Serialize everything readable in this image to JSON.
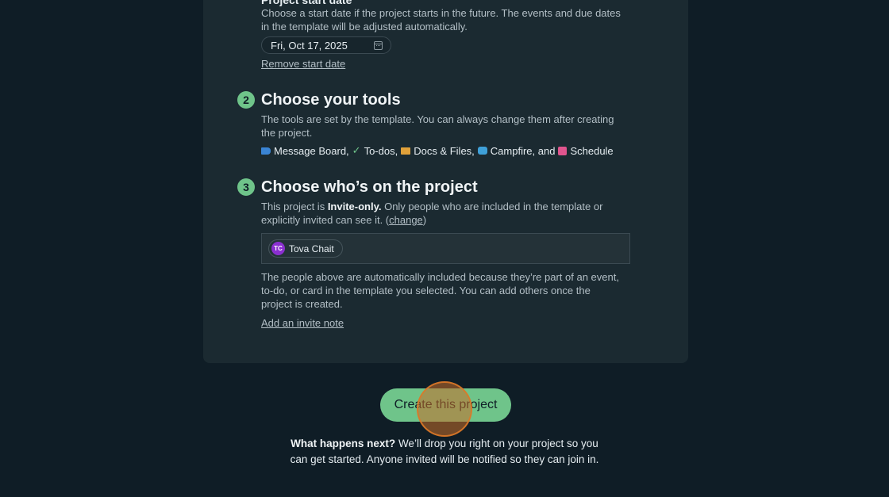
{
  "start_date": {
    "title": "Project start date",
    "description_line1": "Choose a start date if the project starts in the future. The events and due dates",
    "description_line2": "in the template will be adjusted automatically.",
    "date_value": "Fri, Oct 17, 2025",
    "remove_link": "Remove start date"
  },
  "step2": {
    "number": "2",
    "title": "Choose your tools",
    "description_line1": "The tools are set by the template. You can always change them after creating",
    "description_line2": "the project.",
    "tools": [
      {
        "label": "Message Board,",
        "icon": "megaphone-icon"
      },
      {
        "label": "To-dos,",
        "icon": "checkmark-icon"
      },
      {
        "label": "Docs & Files,",
        "icon": "folder-icon"
      },
      {
        "label": "Campfire, and",
        "icon": "chat-bubble-icon"
      },
      {
        "label": "Schedule",
        "icon": "calendar-icon"
      }
    ],
    "todo_glyph": "✓"
  },
  "step3": {
    "number": "3",
    "title": "Choose who’s on the project",
    "access_prefix": "This project is ",
    "access_mode": "Invite-only.",
    "access_suffix": " Only people who are included in the template or",
    "access_line2_prefix": "explicitly invited can see it. (",
    "change_link": "change",
    "access_line2_suffix": ")",
    "people": [
      {
        "initials": "TC",
        "name": "Tova Chait"
      }
    ],
    "note_line1": "The people above are automatically included because they’re part of an event,",
    "note_line2": "to-do, or card in the template you selected. You can add others once the",
    "note_line3": "project is created.",
    "invite_note_link": "Add an invite note"
  },
  "create_button": "Create this project",
  "footer": {
    "bold": "What happens next?",
    "line1_rest": " We’ll drop you right on your project so you",
    "line2": "can get started. Anyone invited will be notified so they can join in."
  },
  "colors": {
    "background": "#0f1d26",
    "card": "#1b2a31",
    "accent_green": "#6fc48a",
    "avatar_purple": "#8a2fd0"
  }
}
